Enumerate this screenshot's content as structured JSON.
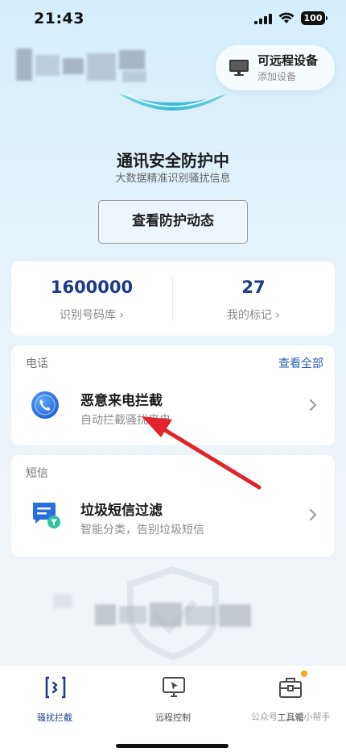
{
  "status": {
    "time": "21:43",
    "battery": "100"
  },
  "header": {
    "remote": {
      "title": "可远程设备",
      "subtitle": "添加设备"
    }
  },
  "hero": {
    "title": "通讯安全防护中",
    "subtitle": "大数据精准识别骚扰信息",
    "button_label": "查看防护动态"
  },
  "stats": [
    {
      "value": "1600000",
      "label": "识别号码库 ›"
    },
    {
      "value": "27",
      "label": "我的标记 ›"
    }
  ],
  "phone_section": {
    "label": "电话",
    "link": "查看全部",
    "item": {
      "title": "恶意来电拦截",
      "subtitle": "自动拦截骚扰来电"
    }
  },
  "sms_section": {
    "label": "短信",
    "item": {
      "title": "垃圾短信过滤",
      "subtitle": "智能分类，告别垃圾短信"
    }
  },
  "tabs": [
    {
      "label": "骚扰拦截",
      "active": true
    },
    {
      "label": "远程控制",
      "active": false
    },
    {
      "label": "工具箱",
      "active": false,
      "badge": true
    }
  ],
  "watermark": "公众号 · 互通小帮手",
  "colors": {
    "accent": "#1b3a8c",
    "link": "#2c5fb8",
    "arrow": "#e0242a",
    "badge": "#f5a623"
  }
}
